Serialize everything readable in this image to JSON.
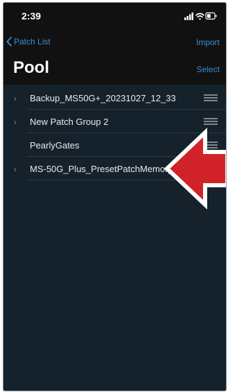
{
  "status_bar": {
    "time": "2:39"
  },
  "nav": {
    "back_label": "Patch List",
    "import_label": "Import",
    "title": "Pool",
    "select_label": "Select"
  },
  "patches": [
    {
      "label": "Backup_MS50G+_20231027_12_33",
      "has_chevron": true
    },
    {
      "label": "New Patch Group 2",
      "has_chevron": true
    },
    {
      "label": "PearlyGates",
      "has_chevron": false
    },
    {
      "label": "MS-50G_Plus_PresetPatchMemory",
      "has_chevron": true
    }
  ],
  "colors": {
    "accent": "#3a8fd6",
    "background": "#15212b",
    "arrow_fill": "#d1222a"
  }
}
